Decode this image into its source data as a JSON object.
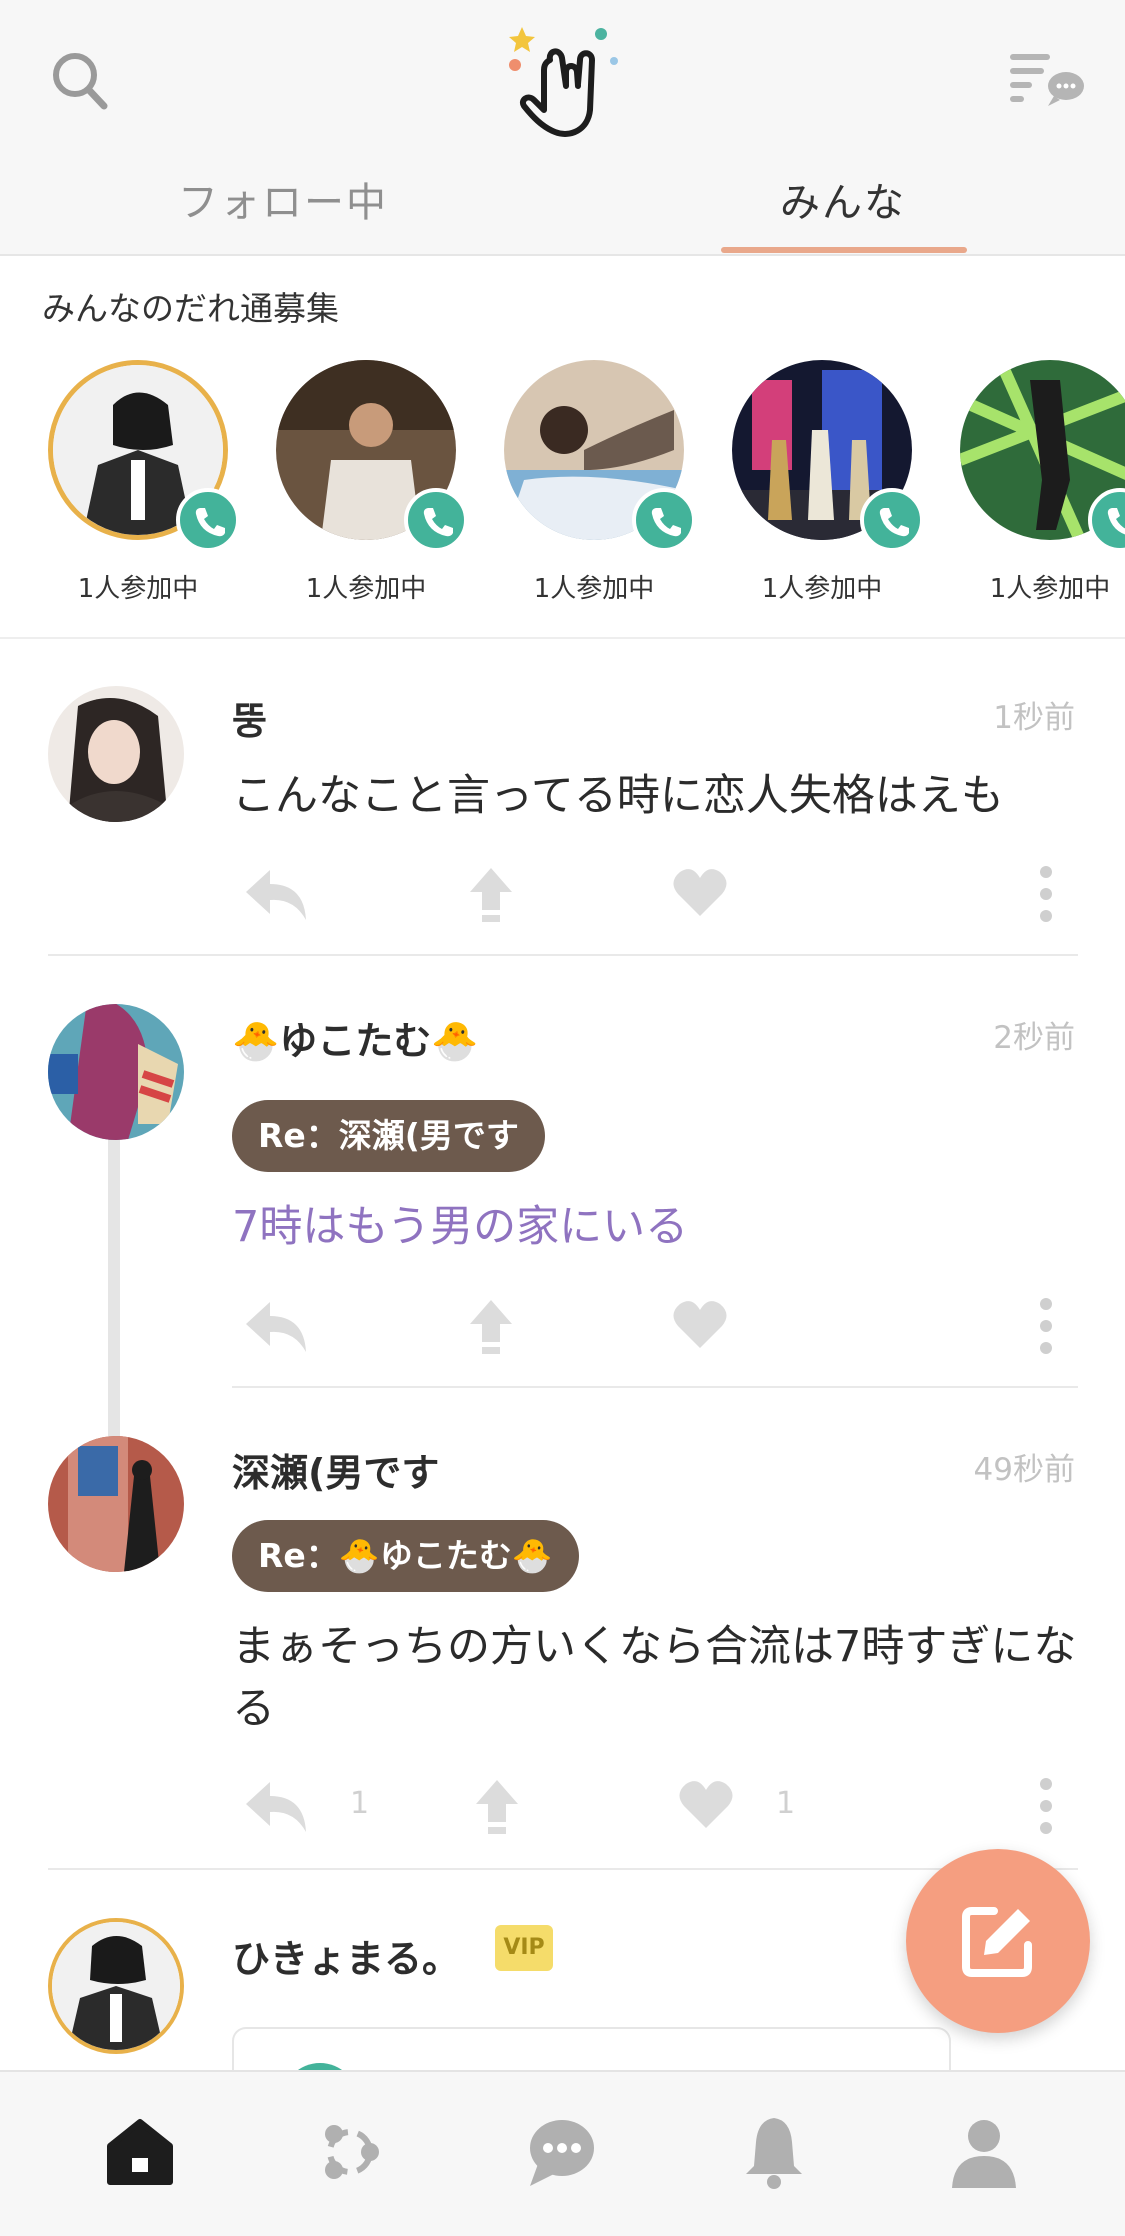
{
  "tabs": {
    "following": "フォロー中",
    "everyone": "みんな",
    "active": "everyone"
  },
  "recruiting": {
    "title": "みんなのだれ通募集",
    "items": [
      {
        "status": "1人参加中"
      },
      {
        "status": "1人参加中"
      },
      {
        "status": "1人参加中"
      },
      {
        "status": "1人参加中"
      },
      {
        "status": "1人参加中"
      }
    ]
  },
  "posts": [
    {
      "name": "뚱",
      "time": "1秒前",
      "text": "こんなこと言ってる時に恋人失格はえも"
    },
    {
      "name": "🐣ゆこたむ🐣",
      "time": "2秒前",
      "reply_to": "Re：深瀬(男です",
      "text": "7時はもう男の家にいる"
    },
    {
      "name": "深瀬(男です",
      "time": "49秒前",
      "reply_to": "Re：🐣ゆこたむ🐣",
      "text": "まぁそっちの方いくなら合流は7時すぎになる",
      "reply_count": "1",
      "like_count": "1"
    },
    {
      "name": "ひきょまる。",
      "badge": "VIP"
    }
  ],
  "icons": {
    "search": "search-icon",
    "logo": "hand-logo-icon",
    "timeline": "timeline-chat-icon",
    "reply": "reply-icon",
    "repost": "repost-icon",
    "like": "heart-icon",
    "more": "more-vertical-icon",
    "call": "phone-icon",
    "compose": "compose-icon",
    "nav": [
      "home-icon",
      "network-icon",
      "chat-icon",
      "bell-icon",
      "profile-icon"
    ]
  },
  "colors": {
    "accent": "#e9a88b",
    "call": "#43b39a",
    "reply_pill": "#6d5a4d",
    "reply_text": "#8f73c0",
    "fab": "#f59e80",
    "vip": "#f5dc6a"
  }
}
